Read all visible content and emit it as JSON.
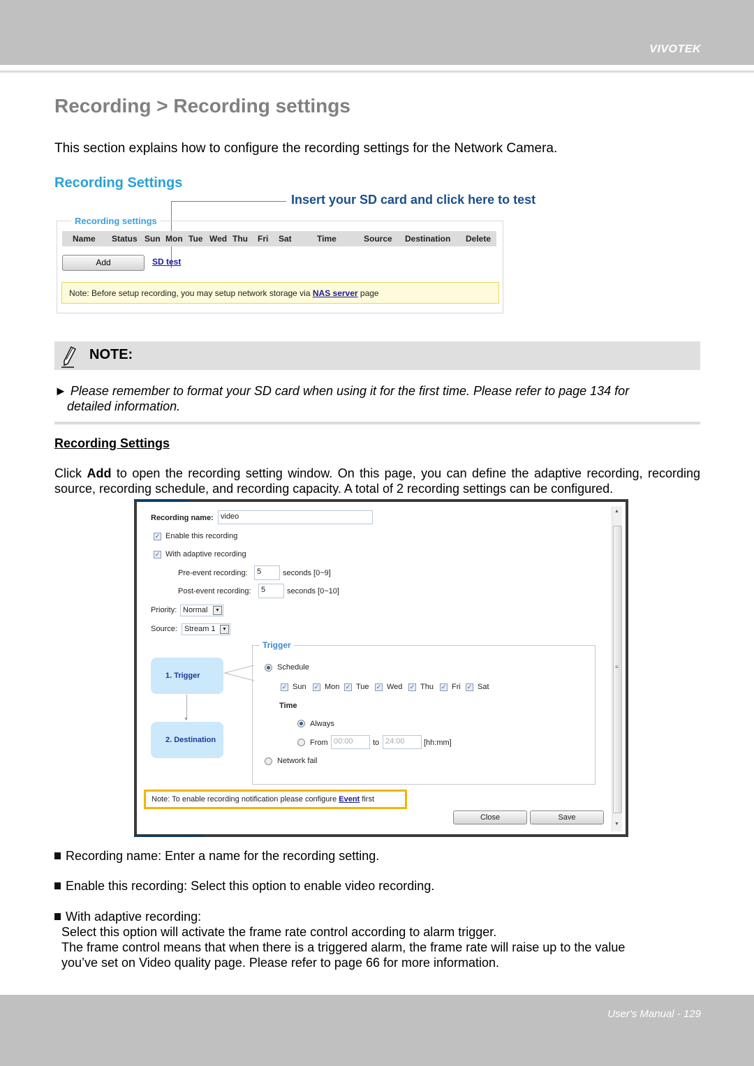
{
  "header": {
    "brand": "VIVOTEK"
  },
  "page": {
    "title": "Recording > Recording settings",
    "intro": "This section explains how to configure the recording settings for the Network Camera."
  },
  "recording_settings_panel": {
    "section_heading": "Recording Settings",
    "callout": "Insert your SD card and click here to test",
    "legend": "Recording settings",
    "columns": [
      "Name",
      "Status",
      "Sun",
      "Mon",
      "Tue",
      "Wed",
      "Thu",
      "Fri",
      "Sat",
      "Time",
      "Source",
      "Destination",
      "Delete"
    ],
    "add_label": "Add",
    "sd_test_label": "SD test",
    "note_prefix": "Note: Before setup recording, you may setup network storage via ",
    "note_link": "NAS server",
    "note_suffix": " page"
  },
  "note_box": {
    "label": "NOTE:",
    "icon": "pencil-icon",
    "line1": "► Please remember to format your SD card when using it for the first time. Please refer to page 134 for",
    "line2": "detailed information."
  },
  "recording_section": {
    "heading": "Recording Settings",
    "para_click": "Click ",
    "para_add": "Add",
    "para_rest": " to open the recording setting window. On this page, you can define the adaptive recording, recording source, recording schedule, and recording capacity. A total of 2 recording settings can be configured."
  },
  "dialog": {
    "recording_name_label": "Recording name:",
    "recording_name_value": "video",
    "enable_label": "Enable this recording",
    "enable_checked": true,
    "adaptive_label": "With adaptive recording",
    "adaptive_checked": true,
    "pre_event_label": "Pre-event recording:",
    "pre_event_value": "5",
    "pre_event_unit": "seconds [0~9]",
    "post_event_label": "Post-event recording:",
    "post_event_value": "5",
    "post_event_unit": "seconds [0~10]",
    "priority_label": "Priority:",
    "priority_value": "Normal",
    "source_label": "Source:",
    "source_value": "Stream 1",
    "step1": "1. Trigger",
    "step2": "2. Destination",
    "trigger_legend": "Trigger",
    "schedule_label": "Schedule",
    "days": [
      {
        "label": "Sun",
        "checked": true
      },
      {
        "label": "Mon",
        "checked": true
      },
      {
        "label": "Tue",
        "checked": true
      },
      {
        "label": "Wed",
        "checked": true
      },
      {
        "label": "Thu",
        "checked": true
      },
      {
        "label": "Fri",
        "checked": true
      },
      {
        "label": "Sat",
        "checked": true
      }
    ],
    "time_label": "Time",
    "always_label": "Always",
    "from_label": "From",
    "from_value": "00:00",
    "to_label": "to",
    "to_value": "24:00",
    "time_format": "[hh:mm]",
    "network_fail_label": "Network fail",
    "event_note_prefix": "Note: To enable recording notification please configure ",
    "event_note_link": "Event",
    "event_note_suffix": " first",
    "close_label": "Close",
    "save_label": "Save"
  },
  "bullets": {
    "b1": "Recording name: Enter a name for the recording setting.",
    "b2": "Enable this recording: Select this option to enable video recording.",
    "b3": "With adaptive recording:",
    "b3_line1": "Select this option will activate the frame rate control according to alarm trigger.",
    "b3_line2": "The frame control means that when there is a triggered alarm, the frame rate will raise up to the value",
    "b3_line3": "you’ve set on Video quality page. Please refer to page 66 for more information."
  },
  "footer": {
    "text": "User's Manual - 129"
  }
}
